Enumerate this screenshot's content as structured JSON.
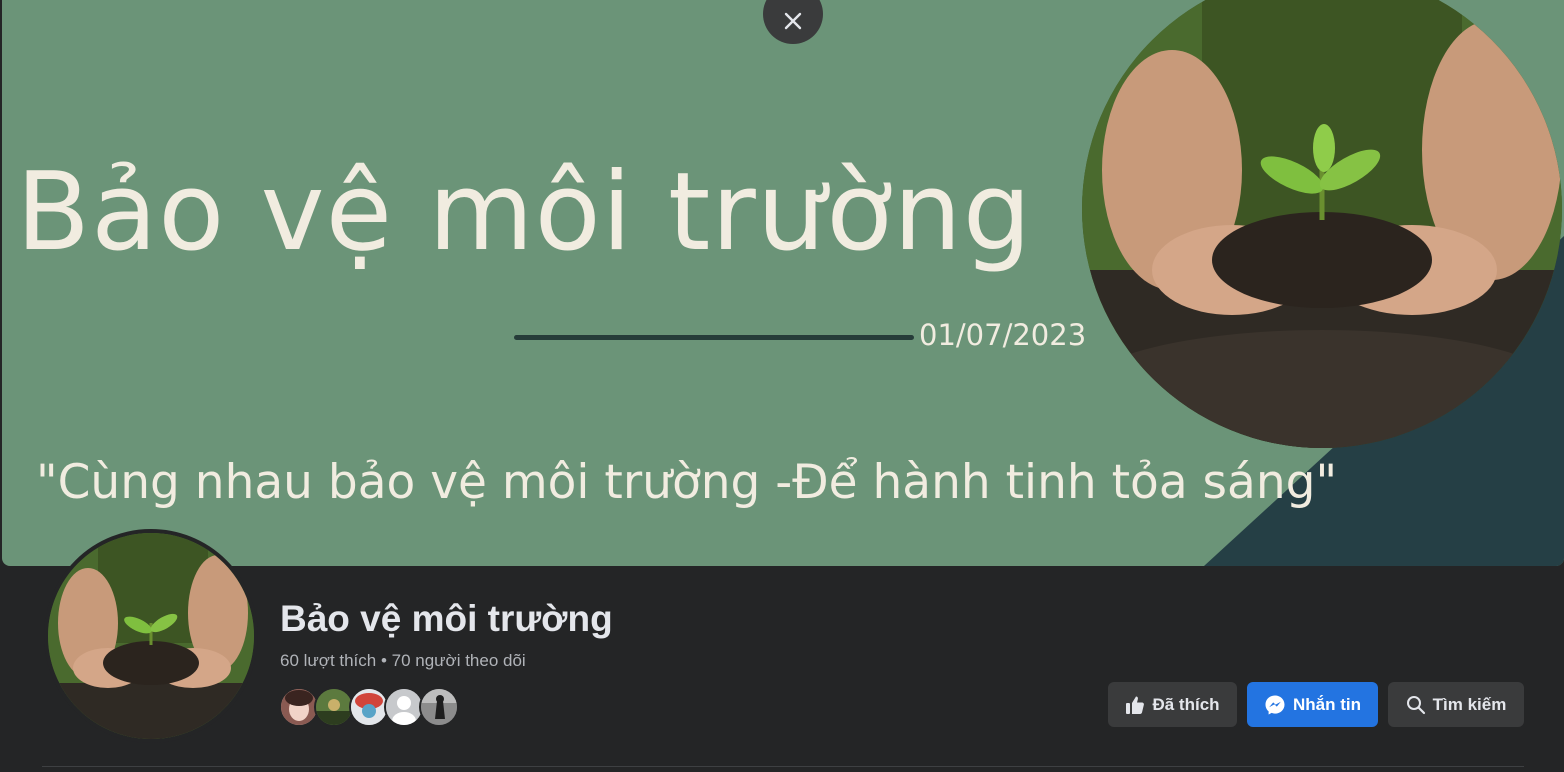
{
  "cover": {
    "title": "Bảo vệ môi trường",
    "date": "01/07/2023",
    "quote": "\"Cùng nhau bảo vệ môi trường -Để hành tinh tỏa sáng\""
  },
  "page": {
    "name": "Bảo vệ môi trường",
    "stats": "60 lượt thích • 70 người theo dõi"
  },
  "actions": {
    "liked_label": "Đã thích",
    "message_label": "Nhắn tin",
    "search_label": "Tìm kiếm"
  },
  "icons": {
    "close": "close-icon",
    "like": "thumbs-up-icon",
    "messenger": "messenger-icon",
    "search": "search-icon"
  },
  "colors": {
    "background": "#242526",
    "cover_green": "#6b9478",
    "cover_dark": "#253f45",
    "button_gray": "#3a3b3c",
    "button_blue": "#2374e1",
    "text_primary": "#e4e6eb",
    "text_secondary": "#b0b3b8"
  }
}
